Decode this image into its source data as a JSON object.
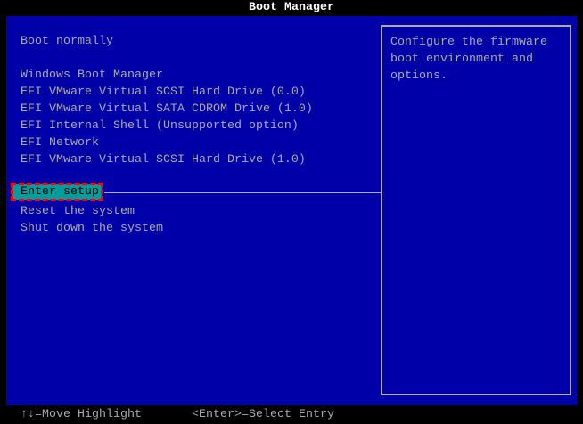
{
  "title": "Boot Manager",
  "menu": {
    "boot_normally": "Boot normally",
    "boot_entries": [
      "Windows Boot Manager",
      "EFI VMware Virtual SCSI Hard Drive (0.0)",
      "EFI VMware Virtual SATA CDROM Drive (1.0)",
      "EFI Internal Shell (Unsupported option)",
      "EFI Network",
      "EFI VMware Virtual SCSI Hard Drive (1.0)"
    ],
    "enter_setup": "Enter setup",
    "reset": "Reset the system",
    "shutdown": "Shut down the system"
  },
  "help": "Configure the firmware boot environment and options.",
  "footer": {
    "move": "↑↓=Move Highlight",
    "select": "<Enter>=Select Entry"
  },
  "colors": {
    "background": "#0000a8",
    "highlight": "#009c9c",
    "text": "#aaaaaa"
  }
}
